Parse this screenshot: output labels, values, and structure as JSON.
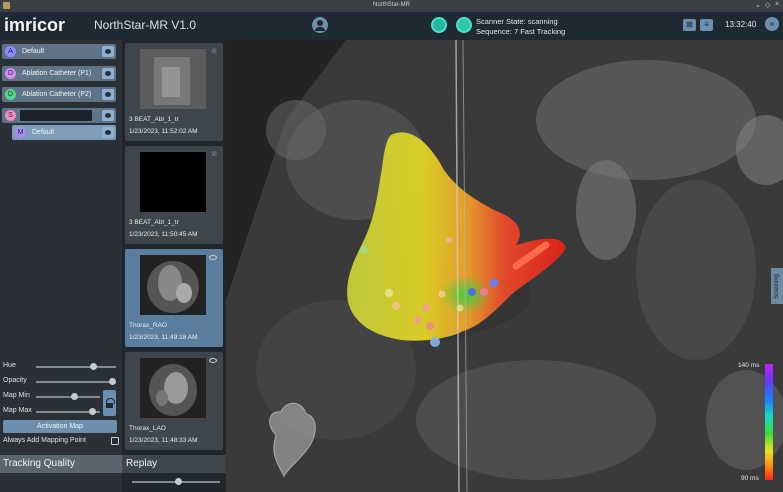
{
  "window": {
    "title": "NorthStar-MR"
  },
  "header": {
    "logo": "imricor",
    "app_title": "NorthStar-MR V1.0",
    "scanner_state": "Scanner State: scanning",
    "sequence": "Sequence: 7 Fast Tracking",
    "clock": "13:32:40"
  },
  "layers": [
    {
      "badge": "A",
      "label": "Default",
      "color": "#8c8cff"
    },
    {
      "badge": "D",
      "label": "Ablation Catheter (P1)",
      "color": "#d08cf0"
    },
    {
      "badge": "D",
      "label": "Ablation Catheter (P2)",
      "color": "#56d88c"
    },
    {
      "badge": "S",
      "label": "",
      "color": "#f08cbf"
    },
    {
      "badge": "M",
      "label": "Default",
      "color": "#a88cf0"
    }
  ],
  "controls": {
    "hue_label": "Hue",
    "hue": 0.78,
    "opacity_label": "Opacity",
    "opacity": 1.0,
    "map_min_label": "Map Min",
    "map_min": 0.55,
    "map_max_label": "Map Max",
    "map_max": 0.85,
    "activation_button": "Activation Map",
    "always_add_label": "Always Add Mapping Point",
    "always_add_checked": false
  },
  "tracking_quality": "Tracking Quality",
  "thumbnails": [
    {
      "name": "3 BEAT_Abl_1_tr",
      "time": "1/23/2023, 11:52:02 AM",
      "selected": false
    },
    {
      "name": "3 BEAT_Abl_1_tr",
      "time": "1/23/2023, 11:50:45 AM",
      "selected": false
    },
    {
      "name": "Thorax_RAO",
      "time": "1/23/2023, 11:49:18 AM",
      "selected": true
    },
    {
      "name": "Thorax_LAO",
      "time": "1/23/2023, 11:48:33 AM",
      "selected": false
    }
  ],
  "replay": {
    "label": "Replay",
    "position": 0.5
  },
  "viewer": {
    "scanning_tab": "Scanning",
    "legend_max": "140 ms",
    "legend_min": "90 ms"
  }
}
